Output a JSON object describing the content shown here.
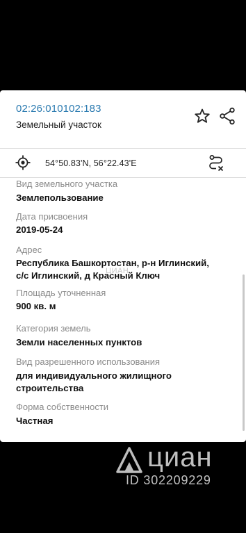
{
  "header": {
    "cadastral_number": "02:26:010102:183",
    "parcel_type": "Земельный участок"
  },
  "coordinates": {
    "text": "54°50.83'N, 56°22.43'E"
  },
  "details": [
    {
      "label": "Вид земельного участка",
      "value": "Землепользование"
    },
    {
      "label": "Дата присвоения",
      "value": "2019-05-24"
    },
    {
      "label": "Адрес",
      "value_lines": [
        "Республика Башкортостан, р-н Иглинский,",
        "с/с Иглинский, д Красный Ключ"
      ]
    },
    {
      "label": "Площадь уточненная",
      "value": "900 кв. м"
    },
    {
      "label": "Категория земель",
      "value": "Земли населенных пунктов"
    },
    {
      "label": "Вид разрешенного использования",
      "value_lines": [
        "для индивидуального жилищного",
        "строительства"
      ]
    },
    {
      "label": "Форма собственности",
      "value": "Частная"
    }
  ],
  "watermark": {
    "mid_text": "ЦИАН",
    "brand": "циан",
    "id_text": "ID 302209229"
  },
  "colors": {
    "link": "#2a7ab0",
    "background": "#000000",
    "sheet": "#ffffff",
    "label": "#8a8a8a"
  }
}
